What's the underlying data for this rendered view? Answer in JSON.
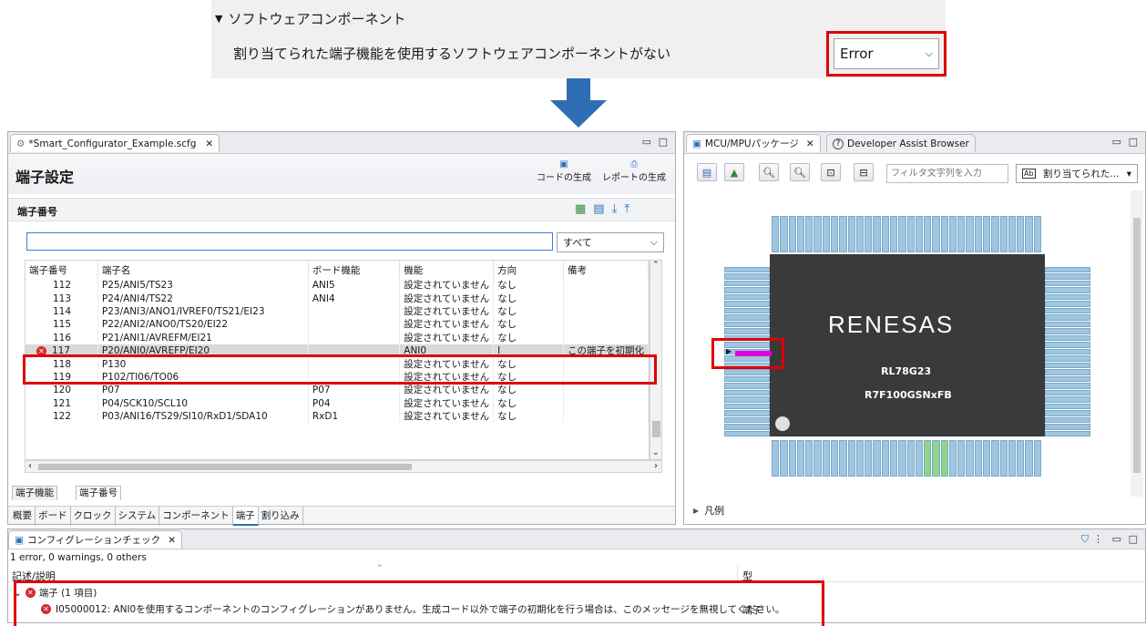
{
  "top": {
    "section_title": "ソフトウェアコンポーネント",
    "rule_text": "割り当てられた端子機能を使用するソフトウェアコンポーネントがない",
    "severity_value": "Error"
  },
  "editor": {
    "tab_title": "*Smart_Configurator_Example.scfg",
    "page_title": "端子設定",
    "generate_code": "コードの生成",
    "generate_report": "レポートの生成",
    "section_label": "端子番号",
    "filter_value": "",
    "filter_select": "すべて",
    "columns": [
      "端子番号",
      "端子名",
      "ボード機能",
      "機能",
      "方向",
      "備考"
    ],
    "rows": [
      {
        "num": "112",
        "name": "P25/ANI5/TS23",
        "board": "ANI5",
        "func": "設定されていません",
        "dir": "なし",
        "note": "",
        "error": false
      },
      {
        "num": "113",
        "name": "P24/ANI4/TS22",
        "board": "ANI4",
        "func": "設定されていません",
        "dir": "なし",
        "note": "",
        "error": false
      },
      {
        "num": "114",
        "name": "P23/ANI3/ANO1/IVREF0/TS21/EI23",
        "board": "",
        "func": "設定されていません",
        "dir": "なし",
        "note": "",
        "error": false
      },
      {
        "num": "115",
        "name": "P22/ANI2/ANO0/TS20/EI22",
        "board": "",
        "func": "設定されていません",
        "dir": "なし",
        "note": "",
        "error": false
      },
      {
        "num": "116",
        "name": "P21/ANI1/AVREFM/EI21",
        "board": "",
        "func": "設定されていません",
        "dir": "なし",
        "note": "",
        "error": false
      },
      {
        "num": "117",
        "name": "P20/ANI0/AVREFP/EI20",
        "board": "",
        "func": "ANI0",
        "dir": "I",
        "note": "この端子を初期化",
        "error": true
      },
      {
        "num": "118",
        "name": "P130",
        "board": "",
        "func": "設定されていません",
        "dir": "なし",
        "note": "",
        "error": false
      },
      {
        "num": "119",
        "name": "P102/TI06/TO06",
        "board": "",
        "func": "設定されていません",
        "dir": "なし",
        "note": "",
        "error": false
      },
      {
        "num": "120",
        "name": "P07",
        "board": "P07",
        "func": "設定されていません",
        "dir": "なし",
        "note": "",
        "error": false
      },
      {
        "num": "121",
        "name": "P04/SCK10/SCL10",
        "board": "P04",
        "func": "設定されていません",
        "dir": "なし",
        "note": "",
        "error": false
      },
      {
        "num": "122",
        "name": "P03/ANI16/TS29/SI10/RxD1/SDA10",
        "board": "RxD1",
        "func": "設定されていません",
        "dir": "なし",
        "note": "",
        "error": false
      }
    ],
    "view_tabs": [
      "端子機能",
      "端子番号"
    ],
    "bottom_tabs": [
      "概要",
      "ボード",
      "クロック",
      "システム",
      "コンポーネント",
      "端子",
      "割り込み"
    ]
  },
  "mcu": {
    "tab_title": "MCU/MPUパッケージ",
    "tab2_title": "Developer Assist Browser",
    "filter_placeholder": "フィルタ文字列を入力",
    "assigned_label": "割り当てられた...",
    "brand": "RENESAS",
    "chip_name": "RL78G23",
    "part_number": "R7F100GSNxFB",
    "legend_label": "凡例"
  },
  "problems": {
    "tab_title": "コンフィグレーションチェック",
    "summary": "1 error, 0 warnings, 0 others",
    "col_desc": "記述/説明",
    "col_type": "型",
    "group_label": "端子 (1 項目)",
    "error_message": "I05000012: ANI0を使用するコンポーネントのコンフィグレーションがありません。生成コード以外で端子の初期化を行う場合は、このメッセージを無視してください。",
    "error_type": "端子"
  },
  "colors": {
    "error_red": "#e00000",
    "arrow_blue": "#2f6db5",
    "pin_blue": "#9ec6e0",
    "chip_body": "#3a3a3a",
    "selected_row": "#d9d9d9"
  }
}
